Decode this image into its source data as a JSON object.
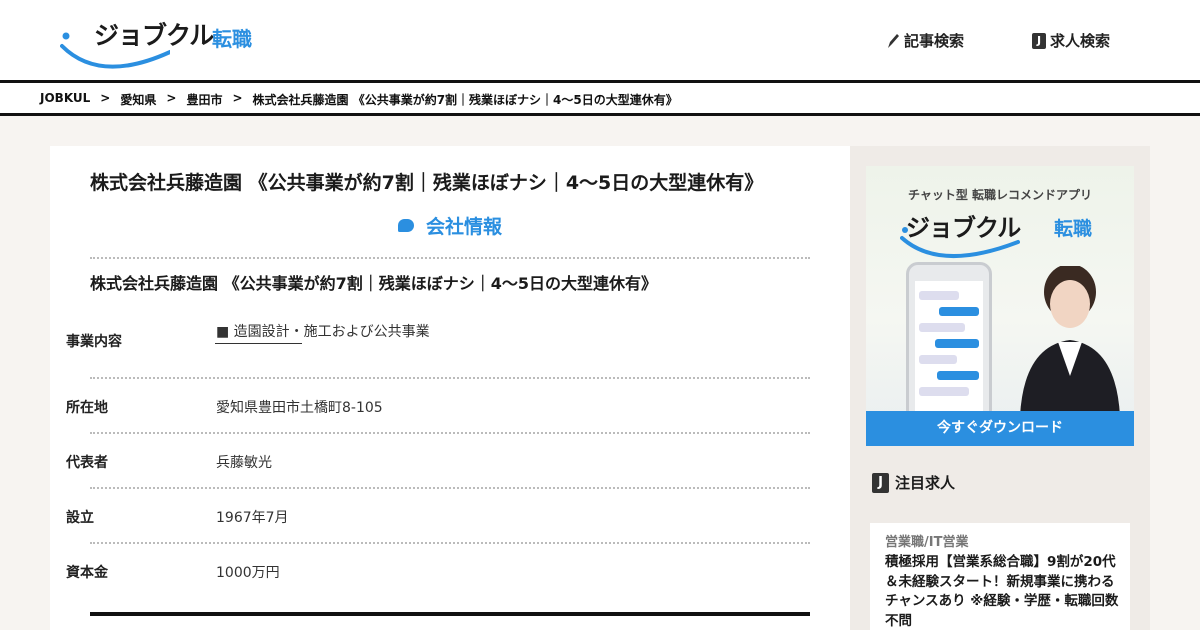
{
  "header": {
    "logo_text": "ジョブクル",
    "logo_sub": "転職",
    "nav_articles": "記事検索",
    "nav_jobs": "求人検索",
    "j_badge": "J"
  },
  "breadcrumb": [
    "JOBKUL",
    "愛知県",
    "豊田市",
    "株式会社兵藤造園 《公共事業が約7割｜残業ほぼナシ｜4～5日の大型連休有》"
  ],
  "breadcrumb_sep": ">",
  "main": {
    "title": "株式会社兵藤造園 《公共事業が約7割｜残業ほぼナシ｜4～5日の大型連休有》",
    "section_heading": "会社情報",
    "company_line": "株式会社兵藤造園 《公共事業が約7割｜残業ほぼナシ｜4～5日の大型連休有》",
    "rows": [
      {
        "label": "事業内容",
        "value": "■ 造園設計・施工および公共事業"
      },
      {
        "label": "所在地",
        "value": "愛知県豊田市土橋町8-105"
      },
      {
        "label": "代表者",
        "value": "兵藤敏光"
      },
      {
        "label": "設立",
        "value": "1967年7月"
      },
      {
        "label": "資本金",
        "value": "1000万円"
      }
    ]
  },
  "sidebar": {
    "banner_tag": "チャット型 転職レコメンドアプリ",
    "banner_logo": "ジョブクル",
    "banner_logo_sub": "転職",
    "banner_button": "今すぐダウンロード",
    "featured_heading": "注目求人",
    "job": {
      "category": "営業職/IT営業",
      "title": "積極採用【営業系総合職】9割が20代＆未経験スタート！新規事業に携わるチャンスあり ※経験・学歴・転職回数不問"
    }
  },
  "colors": {
    "accent_blue": "#2b8fe0",
    "text_dark": "#1b1b1b",
    "page_bg": "#f7f4f1"
  },
  "icons": [
    "pen-icon",
    "j-badge-icon",
    "speech-bubble-icon",
    "smile-arc-icon"
  ]
}
